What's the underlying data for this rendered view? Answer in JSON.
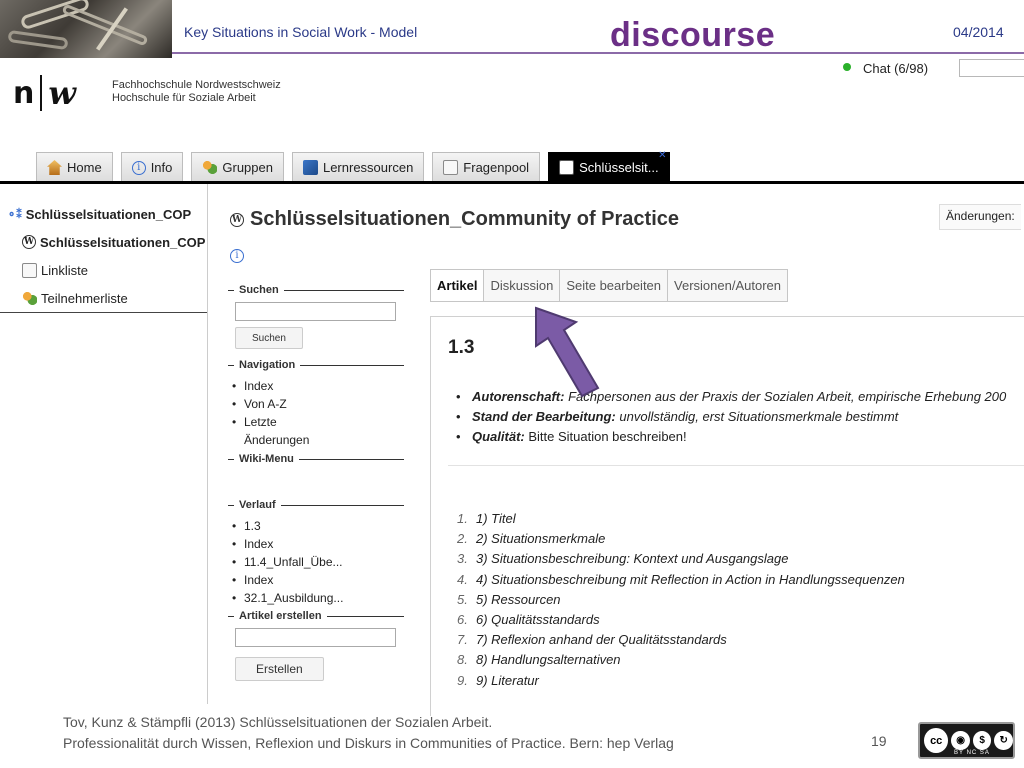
{
  "slide": {
    "title": "Key Situations in Social Work - Model",
    "brand": "discourse",
    "date": "04/2014",
    "page_number": "19",
    "footer_line1": "Tov, Kunz & Stämpfli (2013)  Schlüsselsituationen der Sozialen Arbeit.",
    "footer_line2": "Professionalität durch Wissen, Reflexion und Diskurs  in Communities of Practice. Bern: hep Verlag",
    "license_icons": [
      "cc",
      "by",
      "nc",
      "sa"
    ],
    "license_labels": "BY  NC  SA"
  },
  "header": {
    "logo_letters_left": "n",
    "logo_letters_right": "w",
    "org_line1": "Fachhochschule Nordwestschweiz",
    "org_line2": "Hochschule für Soziale Arbeit",
    "chat_label": "Chat (6/98)",
    "chat_status_color": "#2ab02a"
  },
  "tabs": [
    {
      "label": "Home",
      "icon": "home-icon"
    },
    {
      "label": "Info",
      "icon": "info-icon"
    },
    {
      "label": "Gruppen",
      "icon": "group-icon"
    },
    {
      "label": "Lernressourcen",
      "icon": "book-icon"
    },
    {
      "label": "Fragenpool",
      "icon": "document-icon"
    },
    {
      "label": "Schlüsselsit...",
      "icon": "wiki-icon",
      "active": true
    }
  ],
  "leftnav": [
    {
      "label": "Schlüsselsituationen_COP",
      "icon": "tree-icon"
    },
    {
      "label": "Schlüsselsituationen_COP",
      "icon": "wiki-icon"
    },
    {
      "label": "Linkliste",
      "icon": "document-icon"
    },
    {
      "label": "Teilnehmerliste",
      "icon": "group-icon"
    }
  ],
  "page": {
    "title": "Schlüsselsituationen_Community of Practice",
    "changes_label": "Änderungen:"
  },
  "wiki_sidebar": {
    "search_heading": "Suchen",
    "search_button": "Suchen",
    "navigation_heading": "Navigation",
    "navigation_items": [
      "Index",
      "Von A-Z",
      "Letzte Änderungen"
    ],
    "wiki_menu_heading": "Wiki-Menu",
    "history_heading": "Verlauf",
    "history_items": [
      "1.3",
      "Index",
      "11.4_Unfall_Übe...",
      "Index",
      "32.1_Ausbildung..."
    ],
    "create_heading": "Artikel erstellen",
    "create_button": "Erstellen"
  },
  "article_tabs": [
    "Artikel",
    "Diskussion",
    "Seite bearbeiten",
    "Versionen/Autoren"
  ],
  "article": {
    "heading": "1.3",
    "meta": [
      {
        "label": "Autorenschaft:",
        "value": "Fachpersonen aus der Praxis der Sozialen Arbeit, empirische Erhebung 200"
      },
      {
        "label": "Stand der Bearbeitung:",
        "value": "unvollständig, erst Situationsmerkmale bestimmt"
      },
      {
        "label": "Qualität:",
        "value": "Bitte Situation beschreiben!"
      }
    ],
    "toc": [
      {
        "num": "1.",
        "text": "1) Titel"
      },
      {
        "num": "2.",
        "text": "2) Situationsmerkmale"
      },
      {
        "num": "3.",
        "text": "3) Situationsbeschreibung: Kontext und Ausgangslage"
      },
      {
        "num": "4.",
        "text": "4) Situationsbeschreibung mit Reflection in Action in Handlungssequenzen"
      },
      {
        "num": "5.",
        "text": "5) Ressourcen"
      },
      {
        "num": "6.",
        "text": "6) Qualitätsstandards"
      },
      {
        "num": "7.",
        "text": "7) Reflexion anhand der Qualitätsstandards"
      },
      {
        "num": "8.",
        "text": "8) Handlungsalternativen"
      },
      {
        "num": "9.",
        "text": "9) Literatur"
      }
    ]
  },
  "annotation_arrow_color": "#7b5ba6"
}
